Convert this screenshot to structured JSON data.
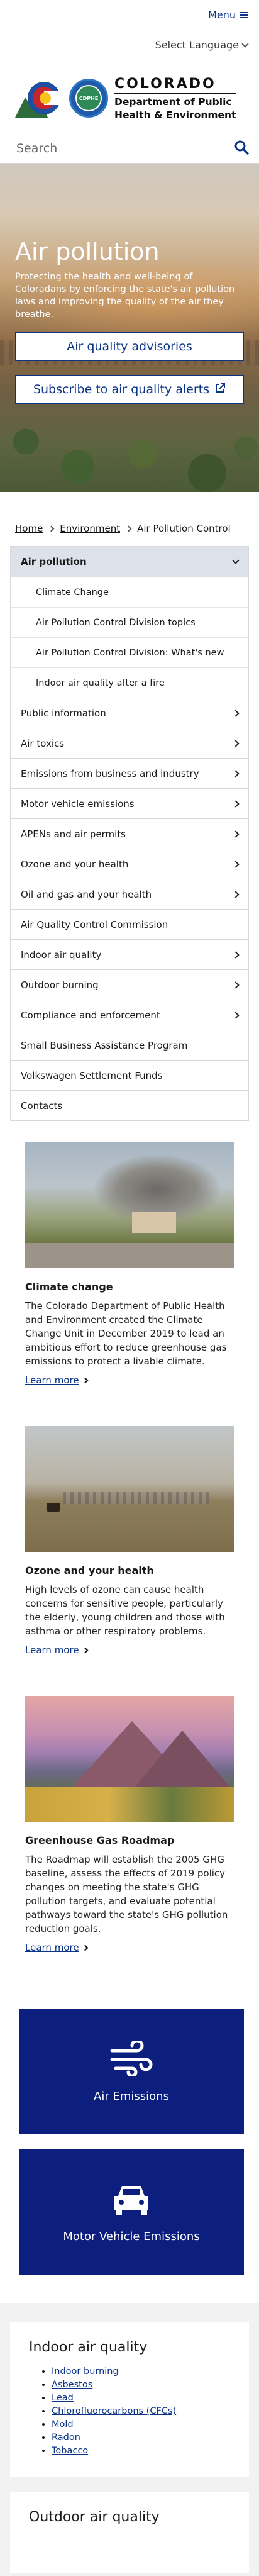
{
  "header": {
    "menu_label": "Menu",
    "language_label": "Select Language",
    "logo_state": "COLORADO",
    "logo_dept_line1": "Department of Public",
    "logo_dept_line2": "Health & Environment",
    "seal_text": "CDPHE"
  },
  "search": {
    "placeholder": "Search"
  },
  "hero": {
    "title": "Air pollution",
    "description": "Protecting the health and well-being of Coloradans by enforcing the state's air pollution laws and improving the quality of the air they breathe.",
    "button_advisories": "Air quality advisories",
    "button_subscribe": "Subscribe to air quality alerts"
  },
  "breadcrumb": {
    "home": "Home",
    "environment": "Environment",
    "current": "Air Pollution Control"
  },
  "sidenav": {
    "active": "Air pollution",
    "sub_items": [
      "Climate Change",
      "Air Pollution Control Division topics",
      "Air Pollution Control Division: What's new",
      "Indoor air quality after a fire"
    ],
    "items": [
      "Public information",
      "Air toxics",
      "Emissions from business and industry",
      "Motor vehicle emissions",
      "APENs and air permits",
      "Ozone and your health",
      "Oil and gas and your health",
      "Air Quality Control Commission",
      "Indoor air quality",
      "Outdoor burning",
      "Compliance and enforcement",
      "Small Business Assistance Program",
      "Volkswagen Settlement Funds",
      "Contacts"
    ]
  },
  "cards": [
    {
      "title": "Climate change",
      "text": "The Colorado Department of Public Health and Environment created the Climate Change Unit in December 2019 to lead an ambitious effort to reduce greenhouse gas emissions to protect a livable climate.",
      "link": "Learn more"
    },
    {
      "title": "Ozone and your health",
      "text": "High levels of ozone can cause health concerns for sensitive people, particularly the elderly, young children and those with asthma or other respiratory problems.",
      "link": "Learn more"
    },
    {
      "title": "Greenhouse Gas Roadmap",
      "text": "The Roadmap will establish the 2005 GHG baseline, assess the effects of 2019 policy changes on meeting the state's GHG pollution targets, and evaluate potential pathways toward the state's GHG pollution reduction goals.",
      "link": "Learn more"
    }
  ],
  "tiles": {
    "air_emissions": "Air Emissions",
    "motor_vehicle": "Motor Vehicle Emissions"
  },
  "indoor": {
    "title": "Indoor air quality",
    "links": [
      "Indoor burning",
      "Asbestos",
      "Lead",
      "Chlorofluorocarbons (CFCs)",
      "Mold",
      "Radon",
      "Tobacco"
    ]
  },
  "outdoor": {
    "title": "Outdoor air quality"
  },
  "colors": {
    "brand_blue": "#0b3487",
    "tile_navy": "#0c1f7f",
    "active_nav_bg": "#dde2ea"
  }
}
